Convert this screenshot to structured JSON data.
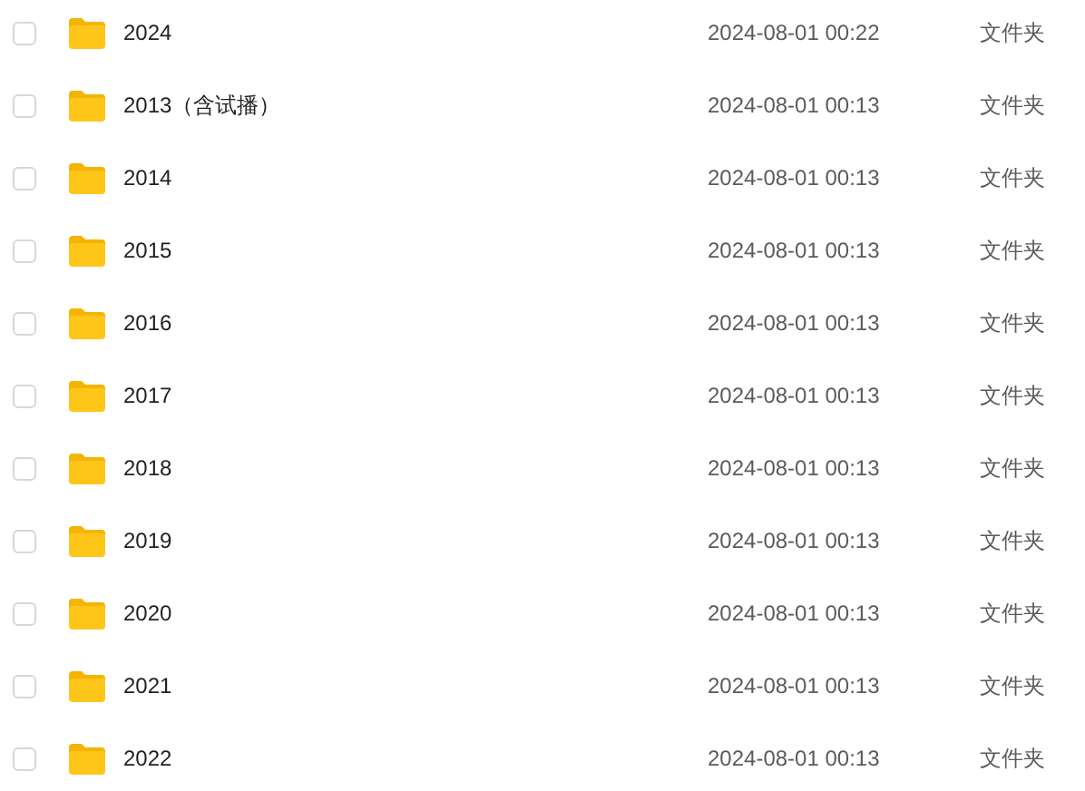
{
  "files": [
    {
      "name": "2024",
      "modified": "2024-08-01 00:22",
      "type": "文件夹",
      "checked": false
    },
    {
      "name": "2013（含试播）",
      "modified": "2024-08-01 00:13",
      "type": "文件夹",
      "checked": false
    },
    {
      "name": "2014",
      "modified": "2024-08-01 00:13",
      "type": "文件夹",
      "checked": false
    },
    {
      "name": "2015",
      "modified": "2024-08-01 00:13",
      "type": "文件夹",
      "checked": false
    },
    {
      "name": "2016",
      "modified": "2024-08-01 00:13",
      "type": "文件夹",
      "checked": false
    },
    {
      "name": "2017",
      "modified": "2024-08-01 00:13",
      "type": "文件夹",
      "checked": false
    },
    {
      "name": "2018",
      "modified": "2024-08-01 00:13",
      "type": "文件夹",
      "checked": false
    },
    {
      "name": "2019",
      "modified": "2024-08-01 00:13",
      "type": "文件夹",
      "checked": false
    },
    {
      "name": "2020",
      "modified": "2024-08-01 00:13",
      "type": "文件夹",
      "checked": false
    },
    {
      "name": "2021",
      "modified": "2024-08-01 00:13",
      "type": "文件夹",
      "checked": false
    },
    {
      "name": "2022",
      "modified": "2024-08-01 00:13",
      "type": "文件夹",
      "checked": false
    }
  ]
}
